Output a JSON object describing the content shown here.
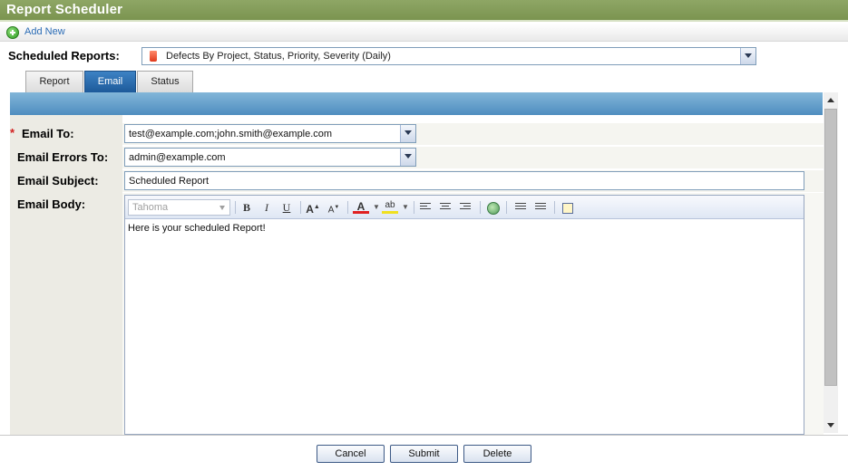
{
  "window": {
    "title": "Report Scheduler"
  },
  "actions": {
    "add_new": "Add New"
  },
  "scheduled_reports": {
    "label": "Scheduled Reports:",
    "selected": "Defects By Project, Status, Priority, Severity (Daily)"
  },
  "tabs": [
    {
      "label": "Report",
      "active": false
    },
    {
      "label": "Email",
      "active": true
    },
    {
      "label": "Status",
      "active": false
    }
  ],
  "form": {
    "required_marker": "*",
    "email_to": {
      "label": "Email To:",
      "value": "test@example.com;john.smith@example.com"
    },
    "email_errors_to": {
      "label": "Email Errors To:",
      "value": "admin@example.com"
    },
    "email_subject": {
      "label": "Email Subject:",
      "value": "Scheduled Report"
    },
    "email_body": {
      "label": "Email Body:",
      "font": "Tahoma",
      "content": "Here is your scheduled Report!",
      "toolbar_icons": [
        "bold-icon",
        "italic-icon",
        "underline-icon",
        "font-size-increase-icon",
        "font-size-decrease-icon",
        "font-color-icon",
        "highlight-icon",
        "align-left-icon",
        "align-center-icon",
        "align-right-icon",
        "link-icon",
        "ordered-list-icon",
        "unordered-list-icon",
        "source-edit-icon"
      ]
    }
  },
  "buttons": {
    "cancel": "Cancel",
    "submit": "Submit",
    "delete": "Delete"
  },
  "colors": {
    "title_bar": "#7b9450",
    "active_tab": "#1d5a9a",
    "link": "#2b6cb5",
    "required": "#d32020"
  }
}
